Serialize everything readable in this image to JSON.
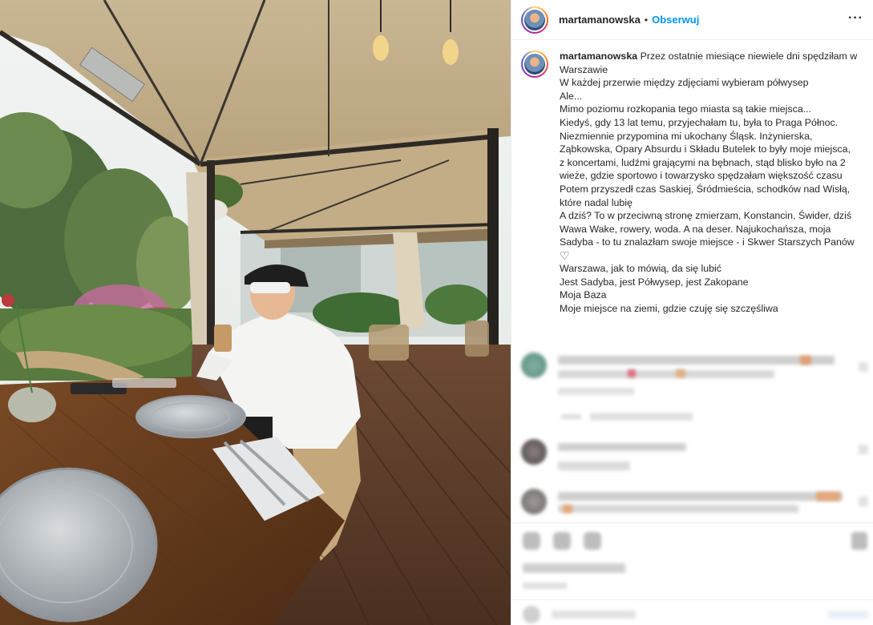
{
  "header": {
    "username": "martamanowska",
    "separator": "•",
    "follow_label": "Obserwuj",
    "more_label": "···"
  },
  "caption": {
    "username": "martamanowska",
    "lines": [
      "Przez ostatnie miesiące niewiele dni spędziłam w",
      "Warszawie",
      "W każdej przerwie między zdjęciami wybieram półwysep",
      "Ale...",
      "Mimo poziomu rozkopania tego miasta są takie miejsca...",
      "Kiedyś, gdy 13 lat temu, przyjechałam tu, była to Praga Północ.",
      "Niezmiennie przypomina mi ukochany Śląsk. Inżynierska,",
      "Ząbkowska, Opary Absurdu i Składu Butelek to były moje miejsca,",
      "z koncertami, ludźmi grającymi na bębnach, stąd blisko było na 2",
      "wieże, gdzie sportowo i towarzysko spędzałam większość czasu",
      "Potem przyszedł czas Saskiej, Śródmieścia, schodków nad Wisłą,",
      "które nadal lubię",
      "A dziś? To w przeciwną stronę zmierzam, Konstancin, Świder, dziś",
      "Wawa Wake, rowery, woda. A na deser. Najukochańsza, moja",
      "Sadyba - to tu znalazłam swoje miejsce - i Skwer Starszych Panów",
      "♡",
      "Warszawa, jak to mówią, da się lubić",
      "Jest Sadyba, jest Półwysep, jest Zakopane",
      "Moja Baza",
      "Moje miejsce na ziemi, gdzie czuję się szczęśliwa"
    ]
  },
  "colors": {
    "follow_blue": "#0095f6",
    "text": "#262626",
    "border": "#efefef"
  },
  "icons": [
    "more-icon",
    "heart-icon",
    "avatar"
  ]
}
